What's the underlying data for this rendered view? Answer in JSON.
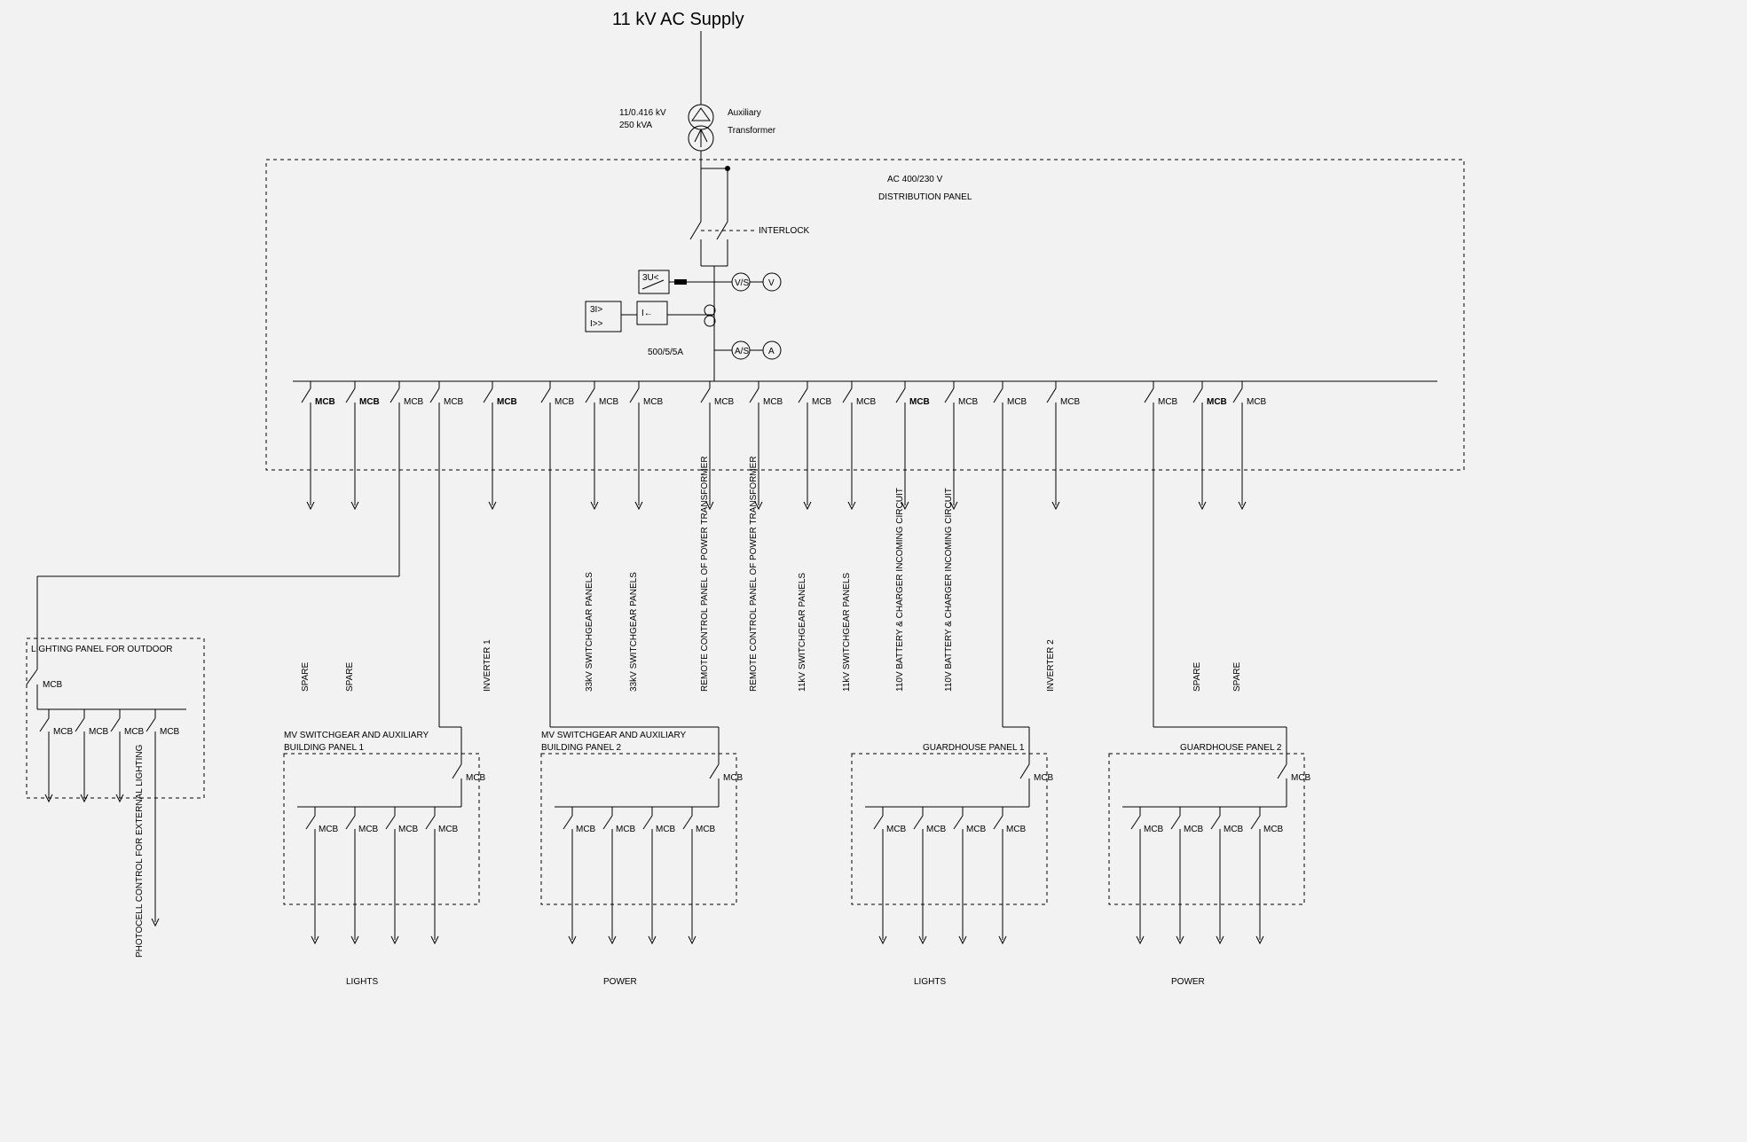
{
  "title": "11 kV AC Supply",
  "transformer": {
    "rating_line1": "11/0.416 kV",
    "rating_line2": "250 kVA",
    "label_line1": "Auxiliary",
    "label_line2": "Transformer"
  },
  "dist_panel": {
    "line1": "AC 400/230 V",
    "line2": "DISTRIBUTION PANEL",
    "interlock": "INTERLOCK",
    "ct": "500/5/5A",
    "relay1": "3U<",
    "relay2a": "3I>",
    "relay2b": "I>>",
    "relay3": "I←",
    "vs": "V/S",
    "v": "V",
    "as": "A/S",
    "a": "A"
  },
  "breaker_label_bold": "MCB",
  "breaker_label": "MCB",
  "feeders": [
    {
      "label": "SPARE",
      "type": "bold"
    },
    {
      "label": "SPARE",
      "type": "bold"
    },
    {
      "label": "",
      "type": "plain"
    },
    {
      "label": "",
      "type": "plain"
    },
    {
      "label": "INVERTER 1",
      "type": "bold"
    },
    {
      "label": "",
      "type": "plain"
    },
    {
      "label": "33kV SWITCHGEAR PANELS",
      "type": "plain"
    },
    {
      "label": "33kV SWITCHGEAR PANELS",
      "type": "plain"
    },
    {
      "label": "REMOTE CONTROL PANEL OF POWER TRANSFORMER",
      "type": "plain"
    },
    {
      "label": "REMOTE CONTROL PANEL OF POWER TRANSFORMER",
      "type": "plain"
    },
    {
      "label": "11kV SWITCHGEAR PANELS",
      "type": "plain"
    },
    {
      "label": "11kV SWITCHGEAR PANELS",
      "type": "plain"
    },
    {
      "label": "110V BATTERY & CHARGER INCOMING CIRCUIT",
      "type": "bold"
    },
    {
      "label": "110V BATTERY & CHARGER INCOMING CIRCUIT",
      "type": "plain"
    },
    {
      "label": "",
      "type": "plain"
    },
    {
      "label": "INVERTER 2",
      "type": "plain"
    },
    {
      "label": "",
      "type": "plain"
    },
    {
      "label": "SPARE",
      "type": "bold"
    },
    {
      "label": "SPARE",
      "type": "plain"
    }
  ],
  "panels": {
    "outdoor": {
      "title": "LIGHTING PANEL FOR OUTDOOR",
      "feeder_label": "PHOTOCELL CONTROL FOR EXTERNAL LIGHTING"
    },
    "mv1": {
      "title": "MV SWITCHGEAR AND AUXILIARY BUILDING PANEL 1",
      "bottom": "LIGHTS"
    },
    "mv2": {
      "title": "MV SWITCHGEAR AND AUXILIARY BUILDING PANEL 2",
      "bottom": "POWER"
    },
    "gh1": {
      "title": "GUARDHOUSE PANEL 1",
      "bottom": "LIGHTS"
    },
    "gh2": {
      "title": "GUARDHOUSE PANEL 2",
      "bottom": "POWER"
    }
  },
  "chart_data": {
    "type": "table",
    "note": "Electrical single-line diagram (schematic, no numeric plot data).",
    "supply": "11 kV AC",
    "transformer": {
      "primary_kV": 11,
      "secondary_kV": 0.416,
      "kVA": 250,
      "type": "Auxiliary Transformer"
    },
    "distribution_panel_voltage": "AC 400/230 V",
    "ct_ratio": "500/5/5A",
    "protection_relays": [
      "3U<",
      "3I> / I>>",
      "I←"
    ],
    "outgoing_feeders_from_distribution_panel": [
      "SPARE",
      "SPARE",
      "to Lighting Panel for Outdoor",
      "to MV Switchgear & Aux Building Panel 1",
      "INVERTER 1",
      "to MV Switchgear & Aux Building Panel 2",
      "33kV SWITCHGEAR PANELS",
      "33kV SWITCHGEAR PANELS",
      "REMOTE CONTROL PANEL OF POWER TRANSFORMER",
      "REMOTE CONTROL PANEL OF POWER TRANSFORMER",
      "11kV SWITCHGEAR PANELS",
      "11kV SWITCHGEAR PANELS",
      "110V BATTERY & CHARGER INCOMING CIRCUIT",
      "110V BATTERY & CHARGER INCOMING CIRCUIT",
      "to Guardhouse Panel 1",
      "INVERTER 2",
      "to Guardhouse Panel 2",
      "SPARE",
      "SPARE"
    ],
    "sub_panels": [
      {
        "name": "LIGHTING PANEL FOR OUTDOOR",
        "outputs": 4,
        "note": "one feeder labelled PHOTOCELL CONTROL FOR EXTERNAL LIGHTING"
      },
      {
        "name": "MV SWITCHGEAR AND AUXILIARY BUILDING PANEL 1",
        "outputs": 4,
        "serves": "LIGHTS"
      },
      {
        "name": "MV SWITCHGEAR AND AUXILIARY BUILDING PANEL 2",
        "outputs": 4,
        "serves": "POWER"
      },
      {
        "name": "GUARDHOUSE PANEL 1",
        "outputs": 4,
        "serves": "LIGHTS"
      },
      {
        "name": "GUARDHOUSE PANEL 2",
        "outputs": 4,
        "serves": "POWER"
      }
    ]
  }
}
